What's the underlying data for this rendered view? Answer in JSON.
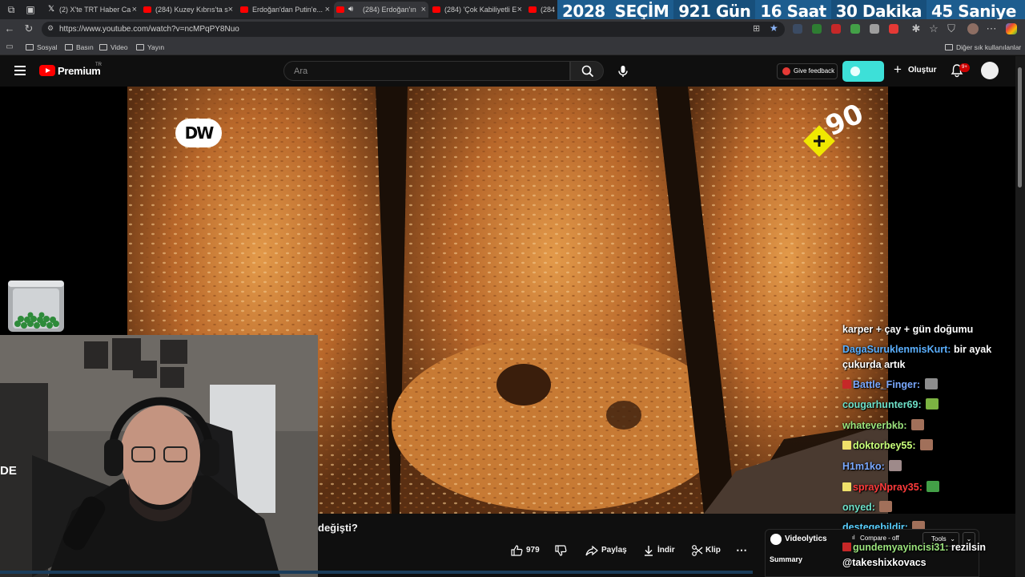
{
  "browser": {
    "tabs": [
      {
        "label": "(2) X'te TRT Haber Ca",
        "favicon": "x-icon"
      },
      {
        "label": "(284) Kuzey Kıbrıs'ta s",
        "favicon": "youtube-icon"
      },
      {
        "label": "Erdoğan'dan Putin'e...",
        "favicon": "youtube-icon"
      },
      {
        "label": "(284) Erdoğan'ın",
        "favicon": "youtube-icon",
        "active": true,
        "audio": true
      },
      {
        "label": "(284) 'Çok Kabiliyetli E",
        "favicon": "youtube-icon"
      },
      {
        "label": "(284",
        "favicon": "youtube-icon"
      }
    ],
    "url": "https://www.youtube.com/watch?v=ncMPqPY8Nuo",
    "bookmarks": [
      "Sosyal",
      "Basın",
      "Video",
      "Yayın"
    ],
    "other_bookmarks": "Diğer sık kullanılanlar"
  },
  "countdown": {
    "items": [
      "2028",
      "SEÇİM",
      "921 Gün",
      "16 Saat",
      "30 Dakika",
      "45 Saniye"
    ]
  },
  "youtube": {
    "logo_text": "Premium",
    "country_code": "TR",
    "search_placeholder": "Ara",
    "feedback_label": "Give feedback",
    "create_label": "Oluştur",
    "notification_count": "9+"
  },
  "video": {
    "channel_logo_text": "DW",
    "corner_badge_text": "90",
    "title_visible": "değişti?",
    "actions": {
      "likes": "979",
      "share": "Paylaş",
      "download": "İndir",
      "clip": "Klip"
    }
  },
  "chat": [
    {
      "user": "",
      "message": "karper + çay + gün doğumu"
    },
    {
      "user": "DagaSuruklenmisKurt:",
      "message": "bir ayak"
    },
    {
      "user": "",
      "message": "çukurda artık"
    },
    {
      "user": "Battle_Finger:",
      "message": ""
    },
    {
      "user": "cougarhunter69:",
      "message": ""
    },
    {
      "user": "whateverbkb:",
      "message": ""
    },
    {
      "user": "doktorbey55:",
      "message": ""
    },
    {
      "user": "H1m1ko:",
      "message": ""
    },
    {
      "user": "sprayNpray35:",
      "message": ""
    },
    {
      "user": "onyed:",
      "message": ""
    },
    {
      "user": "destegebildir:",
      "message": ""
    },
    {
      "user": "gundemyayincisi31:",
      "message": "rezilsin"
    },
    {
      "user": "@takeshixkovacs",
      "message": ""
    }
  ],
  "videolytics": {
    "title": "Videolytics",
    "compare_label": "Compare - off",
    "tools_label": "Tools",
    "summary_label": "Summary"
  },
  "colors": {
    "youtube_red": "#ff0000",
    "countdown_bg": "#1d5d8f",
    "accent_teal": "#3de0d8",
    "badge_yellow": "#f0e800"
  }
}
